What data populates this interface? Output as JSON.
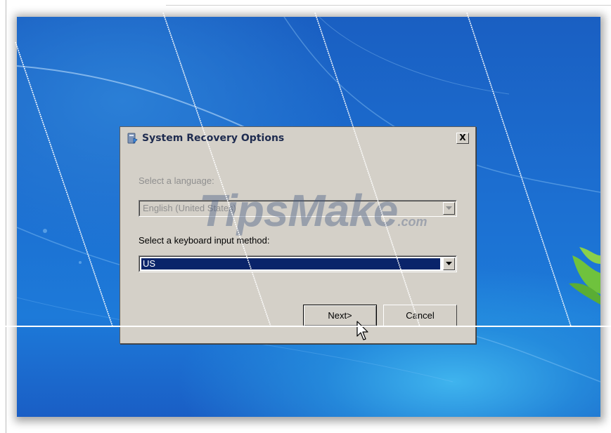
{
  "dialog": {
    "title": "System Recovery Options",
    "close_glyph": "X",
    "title_icon": "recovery-options-icon",
    "language_label": "Select a language:",
    "language_value": "English (United States)",
    "keyboard_label": "Select a keyboard input method:",
    "keyboard_value": "US",
    "next_label": "Next>",
    "cancel_label": "Cancel"
  },
  "watermark": {
    "main": "TipsMake",
    "suffix": ".com"
  },
  "colors": {
    "desktop_blue": "#1c6fd1",
    "dialog_face": "#d4d0c8",
    "selection": "#0a246a",
    "title_text": "#1e2b4f"
  },
  "icons": {
    "close": "close-icon",
    "dropdown": "chevron-down-icon",
    "cursor": "mouse-pointer-icon",
    "leaf": "leaf-icon"
  }
}
